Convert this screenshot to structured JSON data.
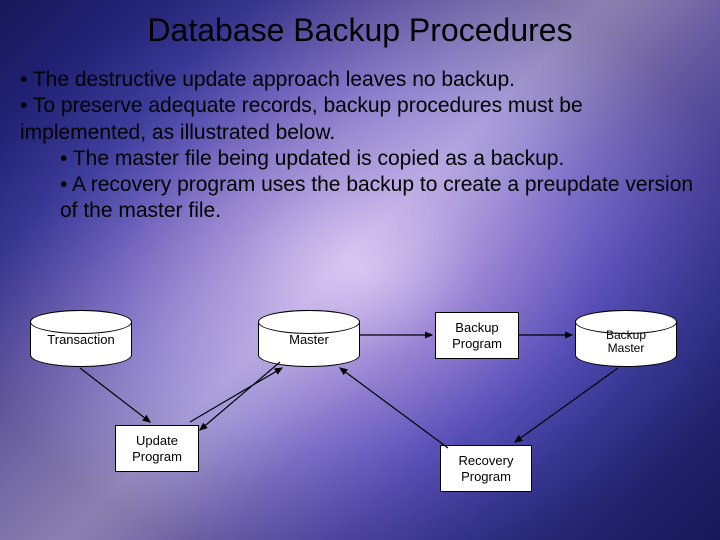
{
  "title": "Database Backup Procedures",
  "bullets": {
    "b1": "The destructive update approach leaves no backup.",
    "b2": "To preserve adequate records, backup procedures must be implemented, as illustrated below.",
    "s1": "The master file being updated is copied as a backup.",
    "s2": "A recovery program uses the backup to create a preupdate version of the master file."
  },
  "diagram": {
    "transaction": "Transaction",
    "master": "Master",
    "backup_program": "Backup\nProgram",
    "backup_master": "Backup\nMaster",
    "update_program": "Update\nProgram",
    "recovery_program": "Recovery\nProgram"
  }
}
